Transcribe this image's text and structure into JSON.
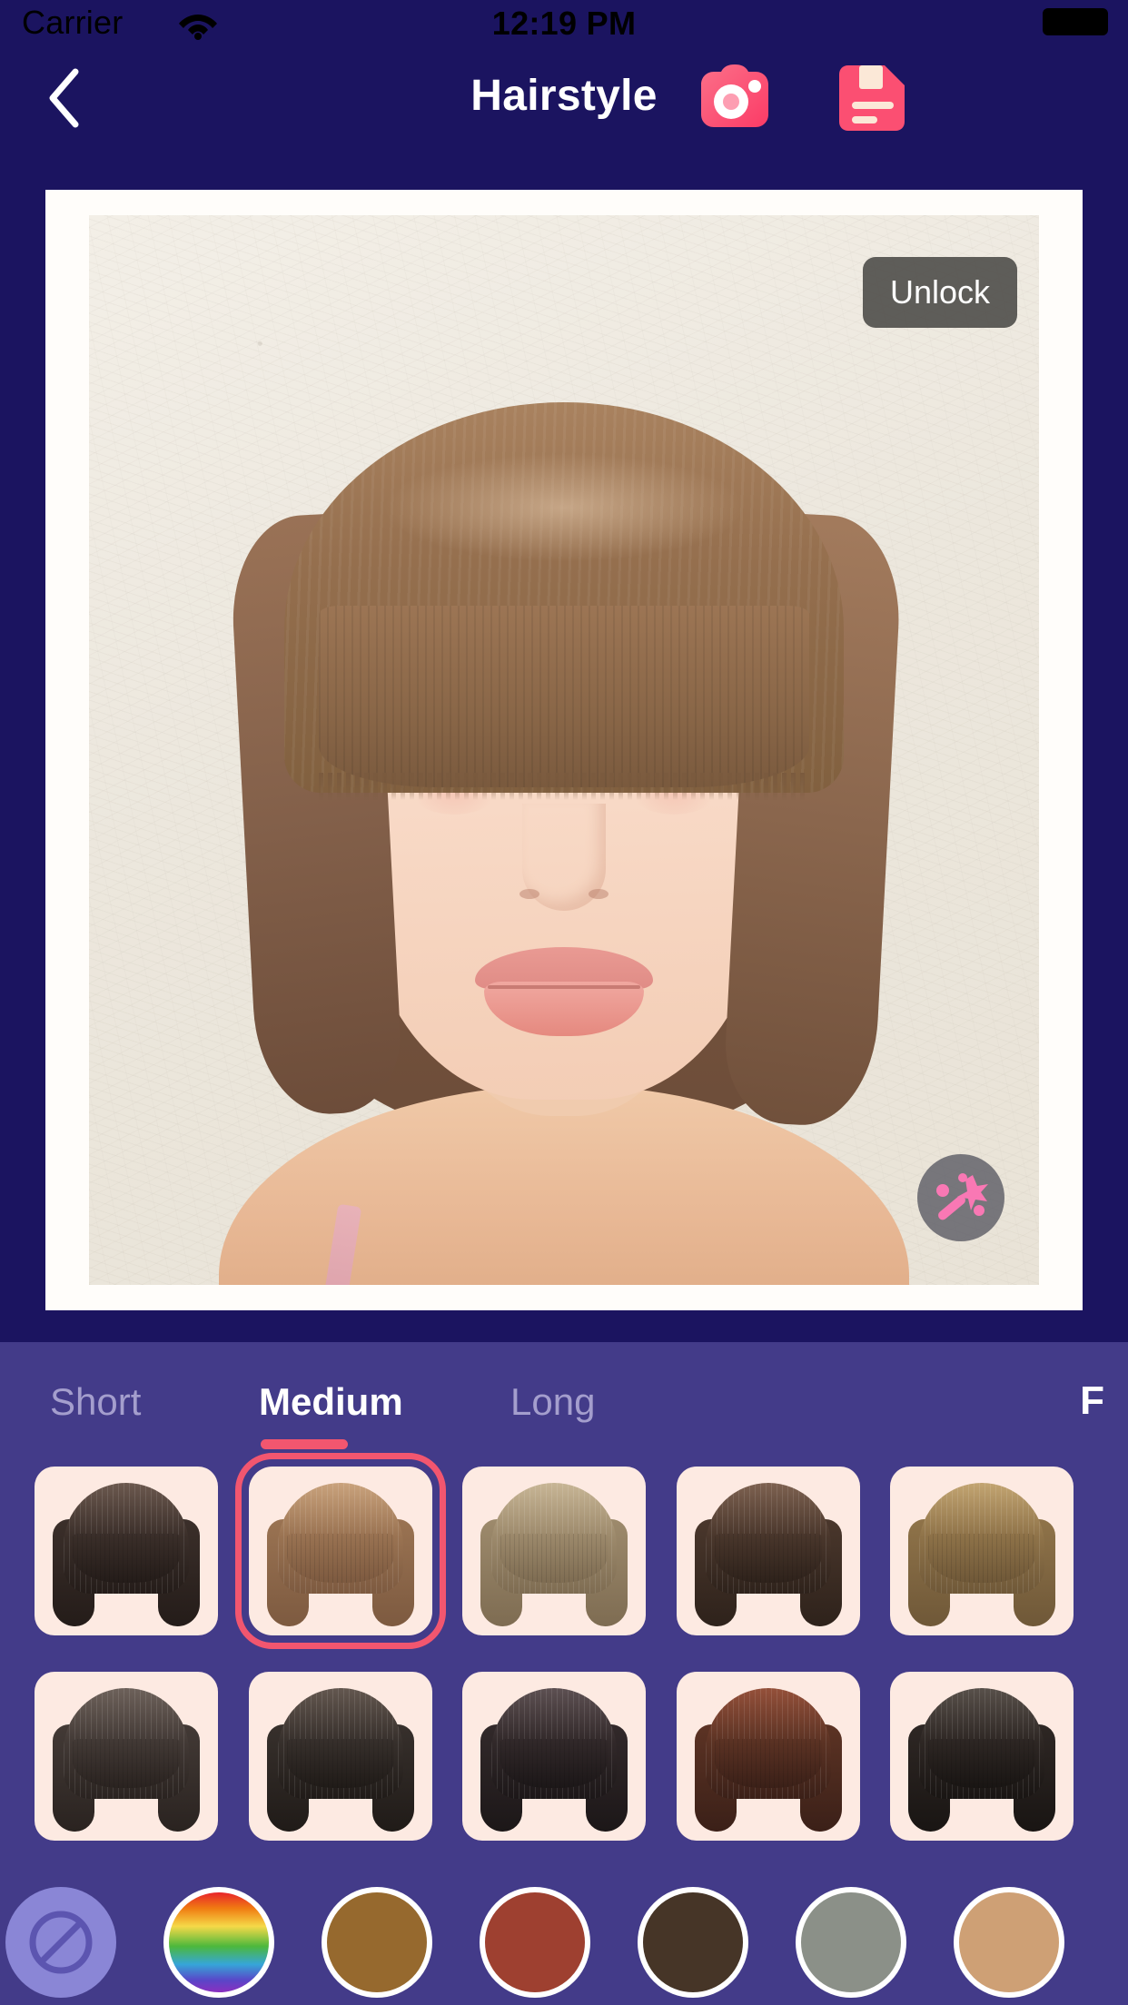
{
  "status_bar": {
    "carrier": "Carrier",
    "time": "12:19 PM",
    "wifi_icon": "wifi-icon",
    "battery_icon": "battery-full-icon"
  },
  "nav_bar": {
    "back_icon": "chevron-left-icon",
    "title": "Hairstyle",
    "camera_icon": "camera-icon",
    "save_icon": "save-document-icon",
    "accent_color": "#fb4f72"
  },
  "photo": {
    "unlock_label": "Unlock",
    "magic_icon": "magic-wand-icon",
    "frame_color": "#fffdfa",
    "backdrop_color": "#ece7dd"
  },
  "tabs": {
    "items": [
      {
        "label": "Short",
        "active": false
      },
      {
        "label": "Medium",
        "active": true
      },
      {
        "label": "Long",
        "active": false
      }
    ],
    "filter_label": "F",
    "active_underline_color": "#f2566f"
  },
  "styles": {
    "selected_index": 1,
    "tile_bg": "#fdeae2",
    "selection_color": "#f2566f",
    "items": [
      {
        "name": "straight-long-bob-dark",
        "base": "#3b2f2a",
        "tip": "#241c19",
        "sheen": "#6b584e"
      },
      {
        "name": "blunt-bob-with-bangs-brown",
        "base": "#9a7352",
        "tip": "#7d5a40",
        "sheen": "#c9a27c"
      },
      {
        "name": "layered-bob-ash-blonde",
        "base": "#9d8a6c",
        "tip": "#7e6c52",
        "sheen": "#c7b595"
      },
      {
        "name": "sleek-bob-dark-brown",
        "base": "#4a372c",
        "tip": "#2e221b",
        "sheen": "#7d6150"
      },
      {
        "name": "wavy-bob-with-clips-caramel",
        "base": "#8f7349",
        "tip": "#6f5838",
        "sheen": "#c2a471"
      },
      {
        "name": "side-part-bob-charcoal",
        "base": "#433a36",
        "tip": "#2a2320",
        "sheen": "#6d615a"
      },
      {
        "name": "long-bob-center-part-black",
        "base": "#37302c",
        "tip": "#201b18",
        "sheen": "#63574f"
      },
      {
        "name": "bob-with-earrings-black",
        "base": "#32292a",
        "tip": "#1c1718",
        "sheen": "#5d5052"
      },
      {
        "name": "rounded-bob-auburn",
        "base": "#5c3324",
        "tip": "#3b2018",
        "sheen": "#94503a"
      },
      {
        "name": "wavy-shoulder-bob-black",
        "base": "#2e2724",
        "tip": "#191513",
        "sheen": "#58504a"
      }
    ]
  },
  "colors": {
    "selected_index": -1,
    "items": [
      {
        "name": "no-color",
        "hex": "none",
        "icon": "no-color-icon"
      },
      {
        "name": "rainbow",
        "hex": "rainbow",
        "icon": ""
      },
      {
        "name": "caramel-brown",
        "hex": "#96692e",
        "icon": ""
      },
      {
        "name": "auburn-red",
        "hex": "#9e4030",
        "icon": ""
      },
      {
        "name": "dark-espresso",
        "hex": "#463527",
        "icon": ""
      },
      {
        "name": "ash-grey",
        "hex": "#8b9088",
        "icon": ""
      },
      {
        "name": "sandy-blonde",
        "hex": "#cea075",
        "icon": ""
      }
    ]
  },
  "theme": {
    "top_bg": "#1b1460",
    "panel_bg": "#433b89",
    "tab_inactive": "#a49ecd"
  }
}
